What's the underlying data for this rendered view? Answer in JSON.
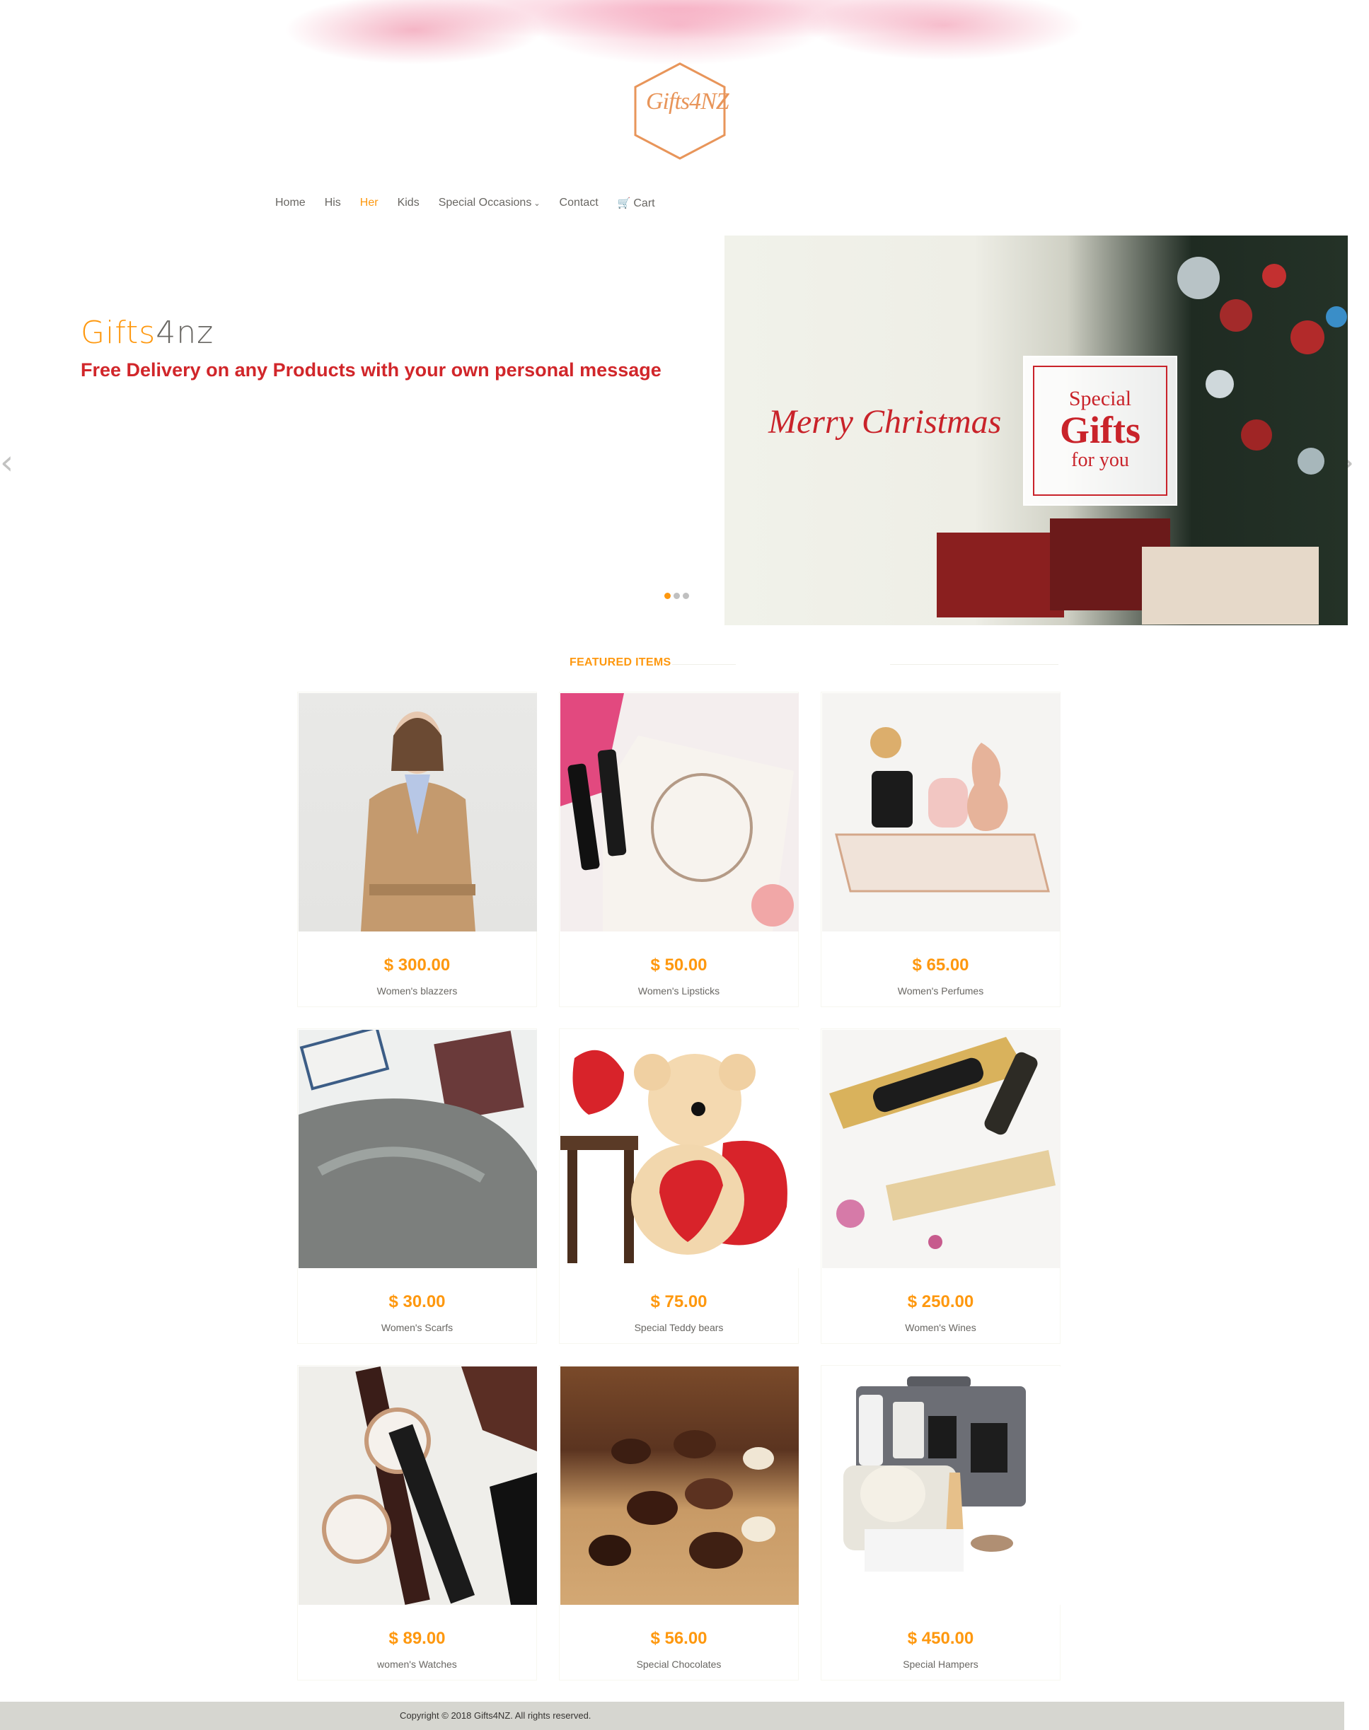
{
  "logo": {
    "text": "Gifts4NZ",
    "color": "#e8955a"
  },
  "nav": {
    "items": [
      {
        "label": "Home"
      },
      {
        "label": "His"
      },
      {
        "label": "Her"
      },
      {
        "label": "Kids"
      },
      {
        "label": "Special Occasions"
      },
      {
        "label": "Contact"
      },
      {
        "label": "Cart"
      }
    ],
    "active": "Her"
  },
  "slider": {
    "brand_part1": "Gifts",
    "brand_part2": "4nz",
    "tagline": "Free Delivery on any Products with your own personal message",
    "image_text_merry": "Merry Christmas",
    "image_text_special": "Special",
    "image_text_gifts": "Gifts",
    "image_text_for_you": "for you",
    "active_slide": 1,
    "slide_count": 3
  },
  "featured": {
    "title": "FEATURED ITEMS",
    "items": [
      {
        "price": "$ 300.00",
        "name": "Women's blazzers"
      },
      {
        "price": "$ 50.00",
        "name": "Women's Lipsticks"
      },
      {
        "price": "$ 65.00",
        "name": "Women's Perfumes"
      },
      {
        "price": "$ 30.00",
        "name": "Women's Scarfs"
      },
      {
        "price": "$ 75.00",
        "name": "Special Teddy bears"
      },
      {
        "price": "$ 250.00",
        "name": "Women's Wines"
      },
      {
        "price": "$ 89.00",
        "name": "women's Watches"
      },
      {
        "price": "$ 56.00",
        "name": "Special Chocolates"
      },
      {
        "price": "$ 450.00",
        "name": "Special Hampers"
      }
    ]
  },
  "footer": {
    "copyright": "Copyright © 2018 Gifts4NZ. All rights reserved."
  },
  "colors": {
    "accent": "#fe980f",
    "tagline_red": "#d1262a",
    "text": "#696763"
  }
}
